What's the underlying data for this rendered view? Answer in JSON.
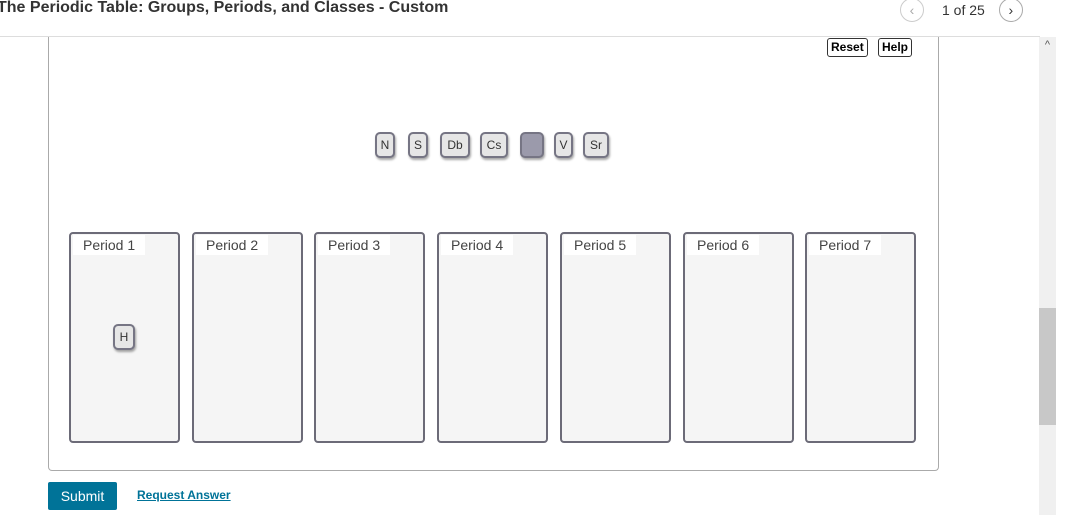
{
  "header": {
    "title": "The Periodic Table: Groups, Periods, and Classes - Custom",
    "pager": {
      "text": "1 of 25",
      "prev_icon": "‹",
      "next_icon": "›"
    }
  },
  "toolbar": {
    "reset_label": "Reset",
    "help_label": "Help"
  },
  "tiles_pool": [
    {
      "label": "N"
    },
    {
      "label": "S"
    },
    {
      "label": "Db"
    },
    {
      "label": "Cs"
    },
    {
      "label": ""
    },
    {
      "label": "V"
    },
    {
      "label": "Sr"
    }
  ],
  "zones": [
    {
      "label": "Period 1",
      "items": [
        "H"
      ]
    },
    {
      "label": "Period 2",
      "items": []
    },
    {
      "label": "Period 3",
      "items": []
    },
    {
      "label": "Period 4",
      "items": []
    },
    {
      "label": "Period 5",
      "items": []
    },
    {
      "label": "Period 6",
      "items": []
    },
    {
      "label": "Period 7",
      "items": []
    }
  ],
  "footer": {
    "submit_label": "Submit",
    "request_answer_label": "Request Answer"
  },
  "scrollbar": {
    "up_icon": "^"
  }
}
